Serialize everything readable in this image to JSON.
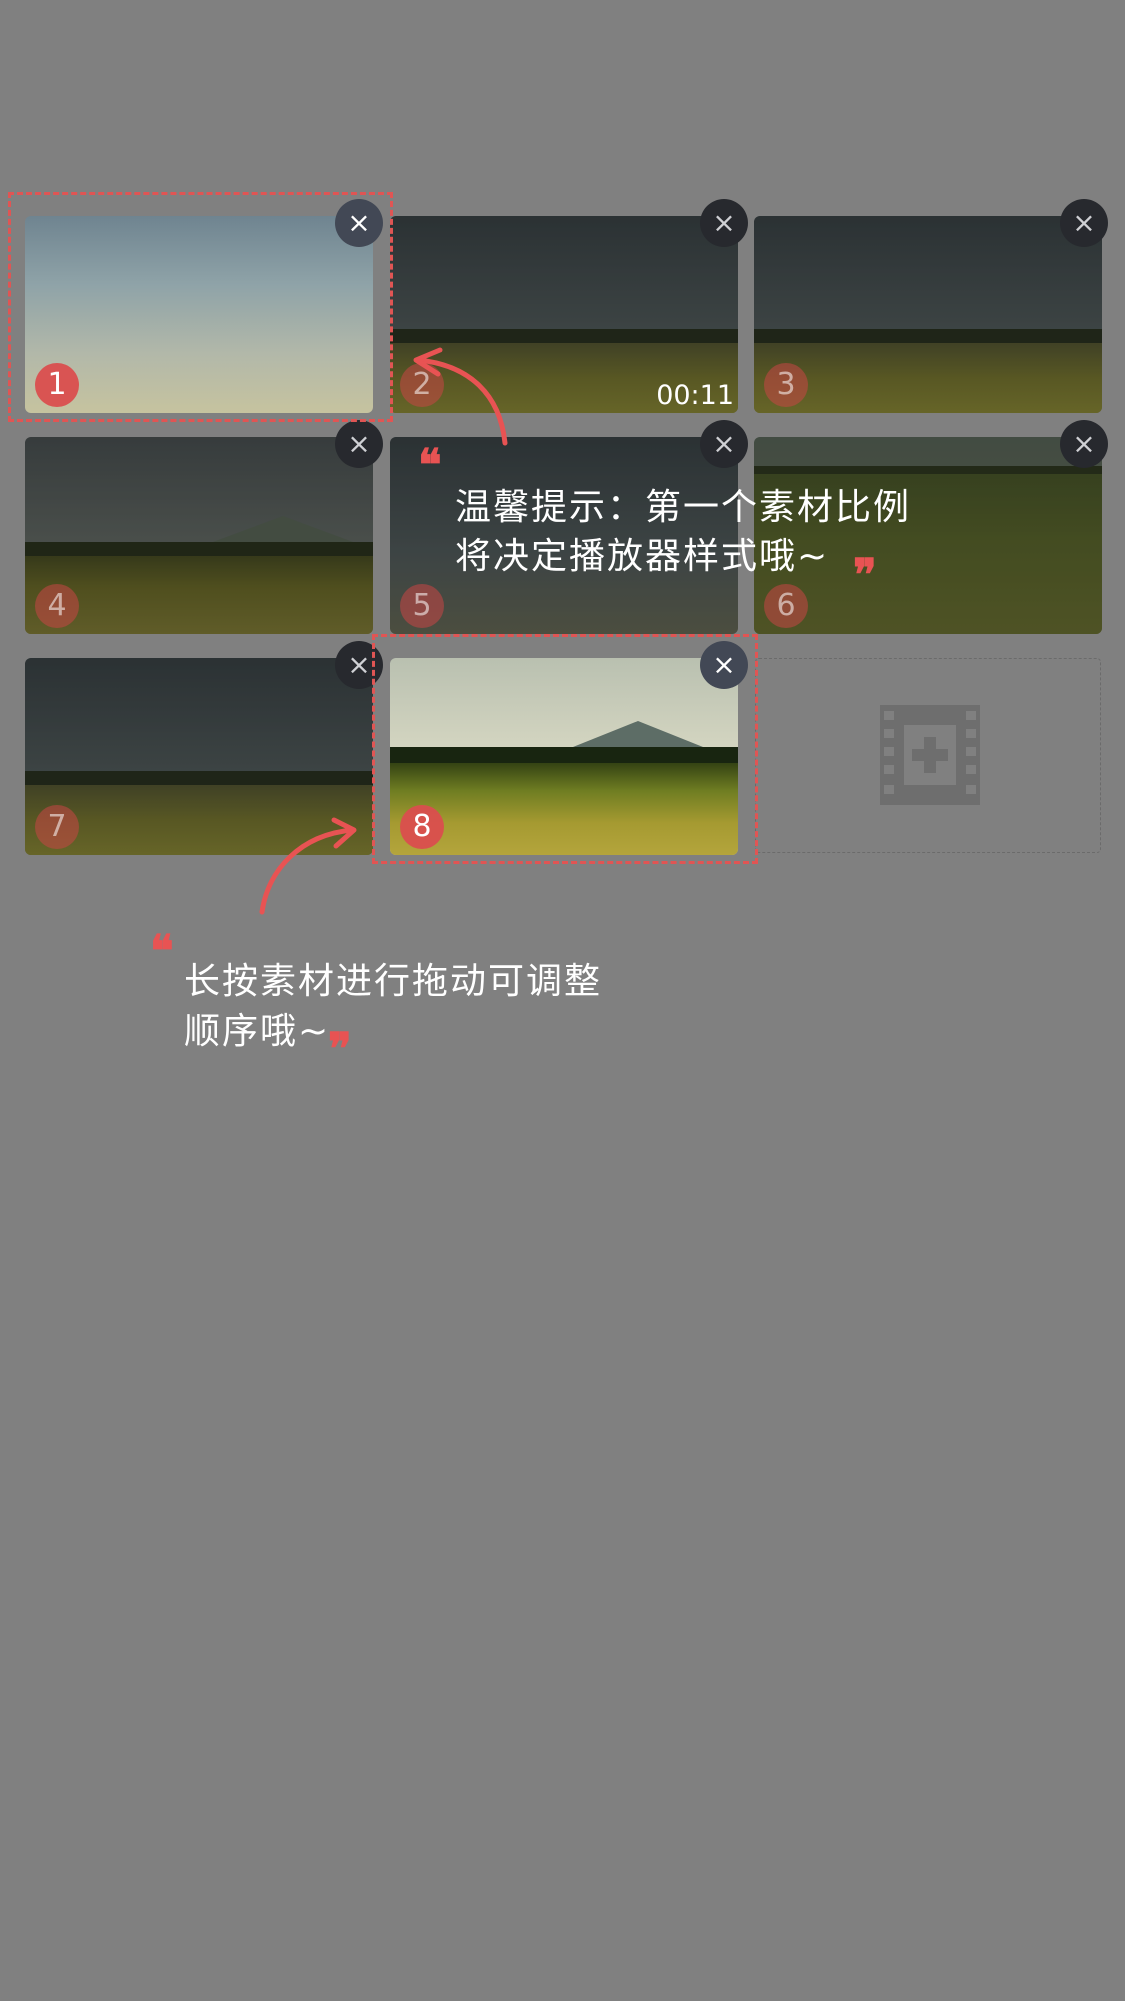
{
  "materials": [
    {
      "num": "1",
      "duration": "",
      "scene": "cloud",
      "active": true
    },
    {
      "num": "2",
      "duration": "00:11",
      "scene": "storm",
      "active": false
    },
    {
      "num": "3",
      "duration": "",
      "scene": "storm",
      "active": false
    },
    {
      "num": "4",
      "duration": "",
      "scene": "mountain",
      "active": false
    },
    {
      "num": "5",
      "duration": "",
      "scene": "storm",
      "active": false
    },
    {
      "num": "6",
      "duration": "",
      "scene": "meadow",
      "active": false
    },
    {
      "num": "7",
      "duration": "",
      "scene": "storm",
      "active": false
    },
    {
      "num": "8",
      "duration": "",
      "scene": "bright",
      "active": true
    }
  ],
  "remove_icon": "×",
  "add_slot": {
    "icon": "film-plus-icon"
  },
  "tips": {
    "first_line1": "温馨提示：第一个素材比例",
    "first_line2": "将决定播放器样式哦~",
    "drag_line1": "长按素材进行拖动可调整",
    "drag_line2": "顺序哦~"
  },
  "colors": {
    "overlay": "#808080",
    "accent": "#e85353"
  }
}
